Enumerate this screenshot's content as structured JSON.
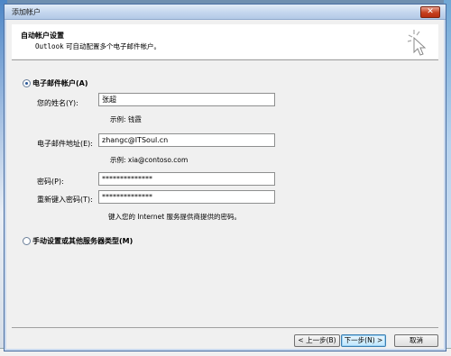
{
  "window": {
    "title": "添加帐户"
  },
  "header": {
    "title": "自动帐户设置",
    "subtitle_app": "Outlook",
    "subtitle_rest": " 可自动配置多个电子邮件帐户。"
  },
  "options": {
    "email_account_label": "电子邮件帐户(A)",
    "manual_label": "手动设置或其他服务器类型(M)"
  },
  "form": {
    "name": {
      "label": "您的姓名(Y):",
      "value": "张超",
      "hint": "示例: 钱霞"
    },
    "email": {
      "label": "电子邮件地址(E):",
      "value": "zhangc@ITSoul.cn",
      "hint": "示例: xia@contoso.com"
    },
    "password": {
      "label": "密码(P):",
      "value": "**************"
    },
    "retype": {
      "label": "重新键入密码(T):",
      "value": "**************",
      "hint": "键入您的 Internet 服务提供商提供的密码。"
    }
  },
  "buttons": {
    "back": "< 上一步(B)",
    "next": "下一步(N) >",
    "cancel": "取消",
    "close": "✕"
  }
}
